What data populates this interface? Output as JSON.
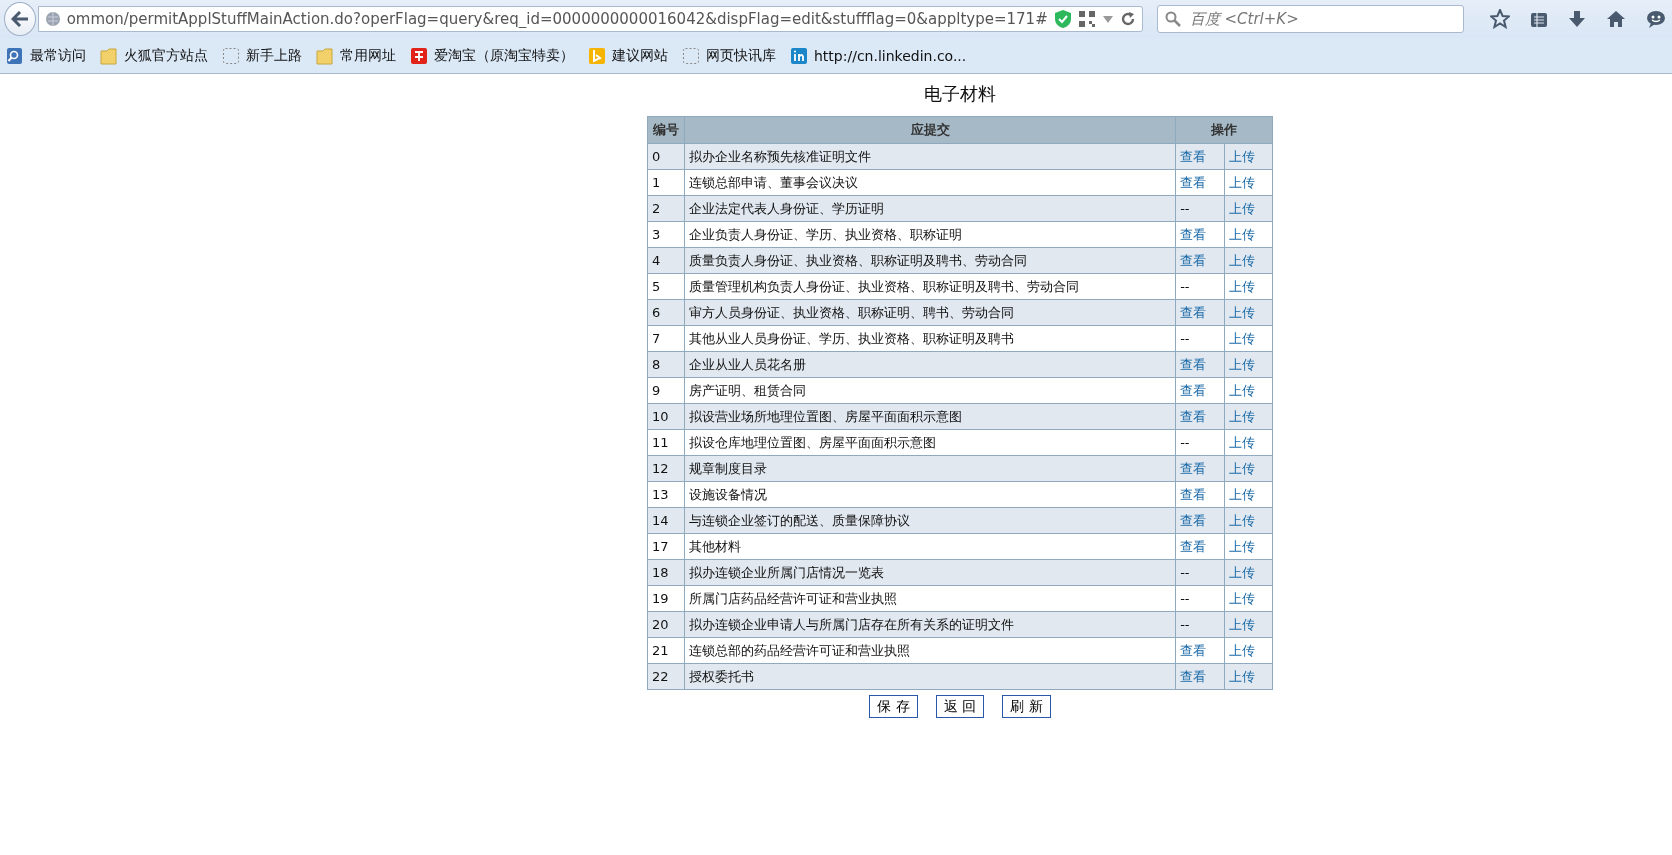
{
  "browser": {
    "url": "ommon/permitApplStuffMainAction.do?operFlag=query&req_id=0000000000016042&dispFlag=edit&stuffflag=0&appltype=171#",
    "search": {
      "placeholder": "百度 <Ctrl+K>"
    }
  },
  "bookmarks": [
    {
      "label": "最常访问",
      "kind": "page"
    },
    {
      "label": "火狐官方站点",
      "kind": "folder"
    },
    {
      "label": "新手上路",
      "kind": "blank"
    },
    {
      "label": "常用网址",
      "kind": "folder"
    },
    {
      "label": "爱淘宝（原淘宝特卖）",
      "kind": "red-tile"
    },
    {
      "label": "建议网站",
      "kind": "yellow-tile"
    },
    {
      "label": "网页快讯库",
      "kind": "blank"
    },
    {
      "label": "http://cn.linkedin.co...",
      "kind": "blue-tile"
    }
  ],
  "page": {
    "title": "电子材料",
    "table": {
      "columns": [
        "编号",
        "应提交",
        "操作"
      ],
      "rows": [
        {
          "no": "0",
          "name": "拟办企业名称预先核准证明文件",
          "view": "查看",
          "viewable": true,
          "upload": "上传"
        },
        {
          "no": "1",
          "name": "连锁总部申请、董事会议决议",
          "view": "查看",
          "viewable": true,
          "upload": "上传"
        },
        {
          "no": "2",
          "name": "企业法定代表人身份证、学历证明",
          "view": "--",
          "viewable": false,
          "upload": "上传"
        },
        {
          "no": "3",
          "name": "企业负责人身份证、学历、执业资格、职称证明",
          "view": "查看",
          "viewable": true,
          "upload": "上传"
        },
        {
          "no": "4",
          "name": "质量负责人身份证、执业资格、职称证明及聘书、劳动合同",
          "view": "查看",
          "viewable": true,
          "upload": "上传"
        },
        {
          "no": "5",
          "name": "质量管理机构负责人身份证、执业资格、职称证明及聘书、劳动合同",
          "view": "--",
          "viewable": false,
          "upload": "上传"
        },
        {
          "no": "6",
          "name": "审方人员身份证、执业资格、职称证明、聘书、劳动合同",
          "view": "查看",
          "viewable": true,
          "upload": "上传"
        },
        {
          "no": "7",
          "name": "其他从业人员身份证、学历、执业资格、职称证明及聘书",
          "view": "--",
          "viewable": false,
          "upload": "上传"
        },
        {
          "no": "8",
          "name": "企业从业人员花名册",
          "view": "查看",
          "viewable": true,
          "upload": "上传"
        },
        {
          "no": "9",
          "name": "房产证明、租赁合同",
          "view": "查看",
          "viewable": true,
          "upload": "上传"
        },
        {
          "no": "10",
          "name": "拟设营业场所地理位置图、房屋平面面积示意图",
          "view": "查看",
          "viewable": true,
          "upload": "上传"
        },
        {
          "no": "11",
          "name": "拟设仓库地理位置图、房屋平面面积示意图",
          "view": "--",
          "viewable": false,
          "upload": "上传"
        },
        {
          "no": "12",
          "name": "规章制度目录",
          "view": "查看",
          "viewable": true,
          "upload": "上传"
        },
        {
          "no": "13",
          "name": "设施设备情况",
          "view": "查看",
          "viewable": true,
          "upload": "上传"
        },
        {
          "no": "14",
          "name": "与连锁企业签订的配送、质量保障协议",
          "view": "查看",
          "viewable": true,
          "upload": "上传"
        },
        {
          "no": "17",
          "name": "其他材料",
          "view": "查看",
          "viewable": true,
          "upload": "上传"
        },
        {
          "no": "18",
          "name": "拟办连锁企业所属门店情况一览表",
          "view": "--",
          "viewable": false,
          "upload": "上传"
        },
        {
          "no": "19",
          "name": "所属门店药品经营许可证和营业执照",
          "view": "--",
          "viewable": false,
          "upload": "上传"
        },
        {
          "no": "20",
          "name": "拟办连锁企业申请人与所属门店存在所有关系的证明文件",
          "view": "--",
          "viewable": false,
          "upload": "上传"
        },
        {
          "no": "21",
          "name": "连锁总部的药品经营许可证和营业执照",
          "view": "查看",
          "viewable": true,
          "upload": "上传"
        },
        {
          "no": "22",
          "name": "授权委托书",
          "view": "查看",
          "viewable": true,
          "upload": "上传"
        }
      ]
    },
    "buttons": [
      "保 存",
      "返 回",
      "刷 新"
    ]
  }
}
